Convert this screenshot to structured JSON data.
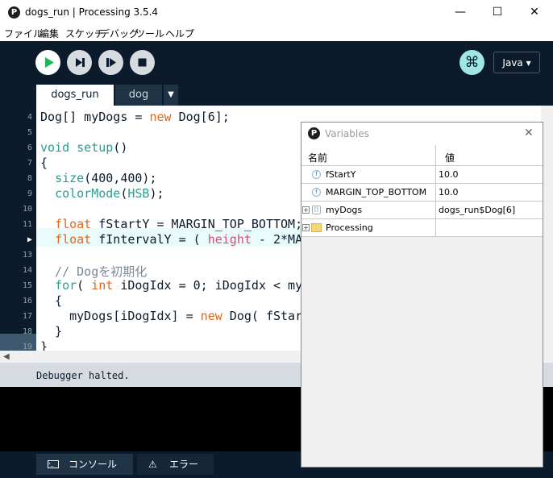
{
  "window": {
    "title": "dogs_run | Processing 3.5.4",
    "app_icon_glyph": "P",
    "minimize": "—",
    "maximize": "☐",
    "close": "✕"
  },
  "menu": [
    "ファイル",
    "編集",
    "スケッチ",
    "デバッグ",
    "ツール",
    "ヘルプ"
  ],
  "toolbar": {
    "debug_glyph": "⌘",
    "mode": "Java ▾"
  },
  "tabs": {
    "active": "dogs_run",
    "other": "dog",
    "menu_glyph": "▼"
  },
  "editor": {
    "lines": [
      {
        "no": "4",
        "text": "Dog[] myDogs = new Dog[6];"
      },
      {
        "no": "5",
        "text": ""
      },
      {
        "no": "6",
        "text": "void setup()"
      },
      {
        "no": "7",
        "text": "{"
      },
      {
        "no": "8",
        "text": "  size(400,400);"
      },
      {
        "no": "9",
        "text": "  colorMode(HSB);"
      },
      {
        "no": "10",
        "text": ""
      },
      {
        "no": "11",
        "text": "  float fStartY = MARGIN_TOP_BOTTOM;"
      },
      {
        "no": "▶",
        "text": "  float fIntervalY = ( height - 2*MA"
      },
      {
        "no": "13",
        "text": ""
      },
      {
        "no": "14",
        "text": "  // Dogを初期化"
      },
      {
        "no": "15",
        "text": "  for( int iDogIdx = 0; iDogIdx < my"
      },
      {
        "no": "16",
        "text": "  {"
      },
      {
        "no": "17",
        "text": "    myDogs[iDogIdx] = new Dog( fStar"
      },
      {
        "no": "18",
        "text": "  }"
      },
      {
        "no": "19",
        "text": "}"
      }
    ]
  },
  "console": {
    "status": "Debugger halted.",
    "tab_console": "コンソール",
    "tab_errors": "エラー"
  },
  "variables": {
    "title": "Variables",
    "col_name": "名前",
    "col_value": "値",
    "rows": [
      {
        "name": "fStartY",
        "value": "10.0",
        "icon": "f"
      },
      {
        "name": "MARGIN_TOP_BOTTOM",
        "value": "10.0",
        "icon": "f"
      },
      {
        "name": "myDogs",
        "value": "dogs_run$Dog[6]",
        "icon": "[]"
      },
      {
        "name": "Processing",
        "value": "",
        "icon": "folder"
      }
    ]
  }
}
